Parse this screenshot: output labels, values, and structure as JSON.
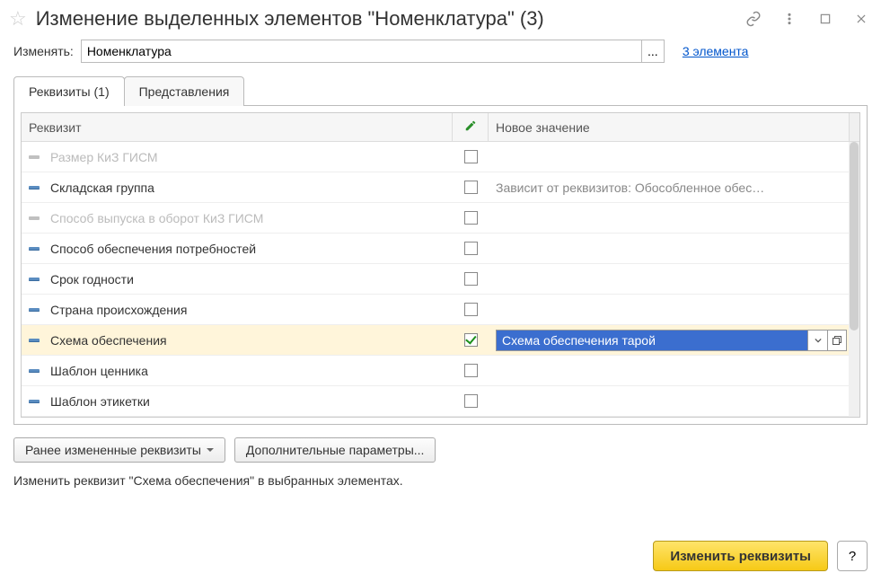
{
  "header": {
    "title": "Изменение выделенных элементов \"Номенклатура\" (3)"
  },
  "change": {
    "label": "Изменять:",
    "value": "Номенклатура",
    "ellipsis": "...",
    "link": "3 элемента"
  },
  "tabs": {
    "t0": "Реквизиты (1)",
    "t1": "Представления"
  },
  "grid": {
    "headers": {
      "name": "Реквизит",
      "value": "Новое значение"
    },
    "rows": [
      {
        "label": "Размер КиЗ ГИСМ",
        "checked": false,
        "disabled": true,
        "value": ""
      },
      {
        "label": "Складская группа",
        "checked": false,
        "disabled": false,
        "value": "Зависит от реквизитов: Обособленное обес…"
      },
      {
        "label": "Способ выпуска в оборот КиЗ ГИСМ",
        "checked": false,
        "disabled": true,
        "value": ""
      },
      {
        "label": "Способ обеспечения потребностей",
        "checked": false,
        "disabled": false,
        "value": ""
      },
      {
        "label": "Срок годности",
        "checked": false,
        "disabled": false,
        "value": ""
      },
      {
        "label": "Страна происхождения",
        "checked": false,
        "disabled": false,
        "value": ""
      },
      {
        "label": "Схема обеспечения",
        "checked": true,
        "disabled": false,
        "value": "Схема обеспечения тарой",
        "selected": true,
        "editing": true
      },
      {
        "label": "Шаблон ценника",
        "checked": false,
        "disabled": false,
        "value": ""
      },
      {
        "label": "Шаблон этикетки",
        "checked": false,
        "disabled": false,
        "value": ""
      }
    ]
  },
  "buttons": {
    "prev": "Ранее измененные реквизиты",
    "extra": "Дополнительные параметры..."
  },
  "hint": "Изменить реквизит \"Схема обеспечения\" в выбранных элементах.",
  "footer": {
    "apply": "Изменить реквизиты",
    "help": "?"
  }
}
